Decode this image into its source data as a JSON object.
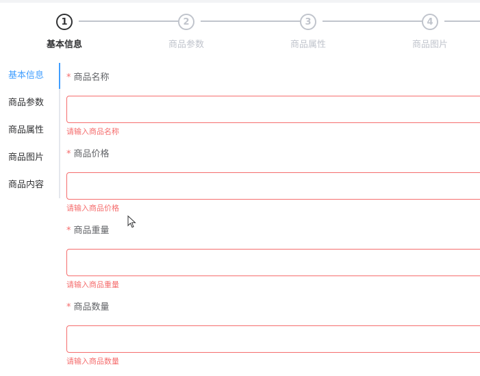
{
  "steps": [
    {
      "number": "1",
      "title": "基本信息"
    },
    {
      "number": "2",
      "title": "商品参数"
    },
    {
      "number": "3",
      "title": "商品属性"
    },
    {
      "number": "4",
      "title": "商品图片"
    }
  ],
  "tabs": [
    {
      "label": "基本信息"
    },
    {
      "label": "商品参数"
    },
    {
      "label": "商品属性"
    },
    {
      "label": "商品图片"
    },
    {
      "label": "商品内容"
    }
  ],
  "form": {
    "required_mark": "*",
    "fields": [
      {
        "label": "商品名称",
        "value": "",
        "error": "请输入商品名称"
      },
      {
        "label": "商品价格",
        "value": "",
        "error": "请输入商品价格"
      },
      {
        "label": "商品重量",
        "value": "",
        "error": "请输入商品重量"
      },
      {
        "label": "商品数量",
        "value": "",
        "error": "请输入商品数量"
      }
    ]
  },
  "colors": {
    "accent": "#409eff",
    "error": "#f56c6c",
    "inactive": "#c0c4cc",
    "text": "#303133"
  },
  "icons": {
    "cursor": "mouse-pointer-icon"
  }
}
